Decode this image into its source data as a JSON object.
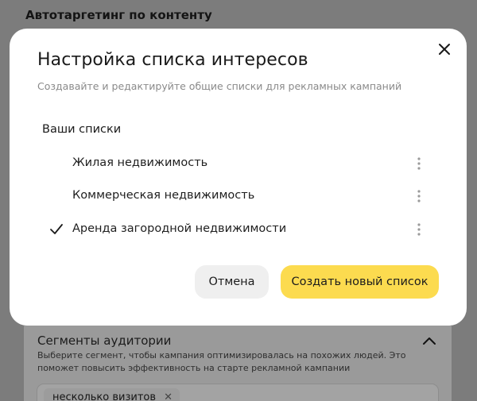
{
  "background": {
    "heading": "Автотаргетинг по контенту",
    "segments_title": "Сегменты аудитории",
    "segments_description": "Выберите сегмент, чтобы кампания оптимизировалась на похожих людей. Это поможет повысить эффективность на старте рекламной кампании",
    "chip_label": "несколько визитов",
    "chip_remove": "✕"
  },
  "modal": {
    "title": "Настройка списка интересов",
    "subtitle": "Создавайте и редактируйте общие списки для рекламных кампаний",
    "section_label": "Ваши списки",
    "lists": [
      {
        "label": "Жилая недвижимость",
        "selected": false
      },
      {
        "label": "Коммерческая недвижимость",
        "selected": false
      },
      {
        "label": "Аренда загородной недвижимости",
        "selected": true
      }
    ],
    "cancel_label": "Отмена",
    "create_label": "Создать новый список"
  },
  "colors": {
    "accent": "#fcdb4f",
    "cancel_bg": "#efefef",
    "overlay": "#7c7c7c"
  }
}
